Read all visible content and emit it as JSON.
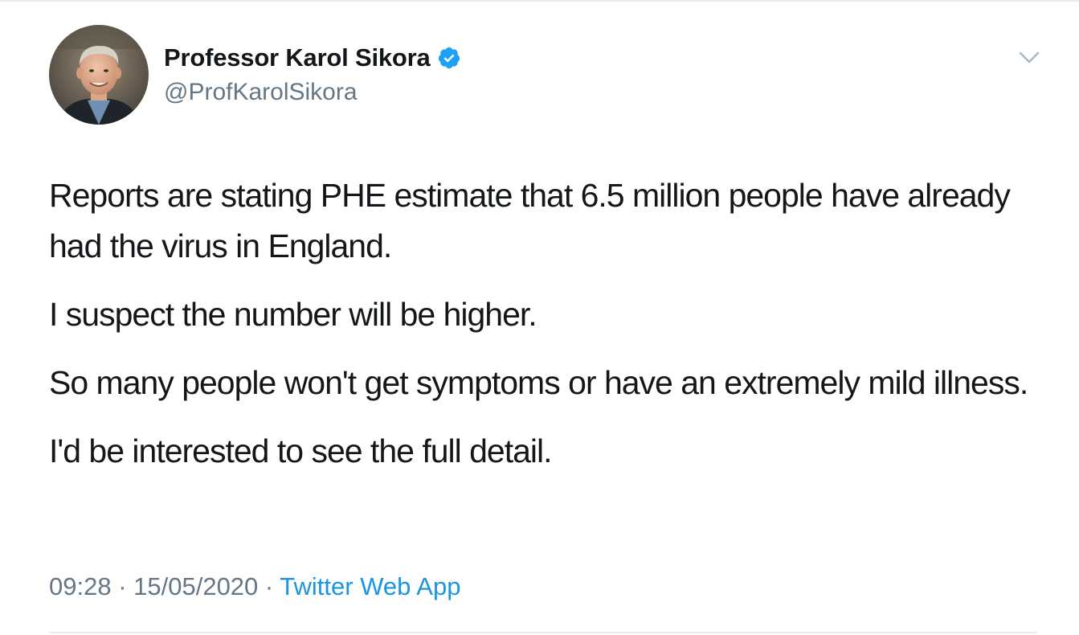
{
  "tweet": {
    "author": {
      "display_name": "Professor Karol Sikora",
      "handle": "@ProfKarolSikora",
      "verified": true,
      "avatar": "profile-photo-man-grey-hair"
    },
    "paragraphs": [
      "Reports are stating PHE estimate that 6.5 million people have already had the virus in England.",
      "I suspect the number will be higher.",
      "So many people won't get symptoms or have an extremely mild illness.",
      "I'd be interested to see the full detail."
    ],
    "meta": {
      "time": "09:28",
      "separator": " · ",
      "date": "15/05/2020",
      "source": "Twitter Web App"
    },
    "icons": {
      "verified": "verified-badge-icon",
      "menu": "chevron-down-icon"
    },
    "colors": {
      "accent": "#1da1f2",
      "link": "#1b95e0",
      "secondary_text": "#657786",
      "primary_text": "#14171a",
      "divider": "#e6ecf0"
    }
  }
}
